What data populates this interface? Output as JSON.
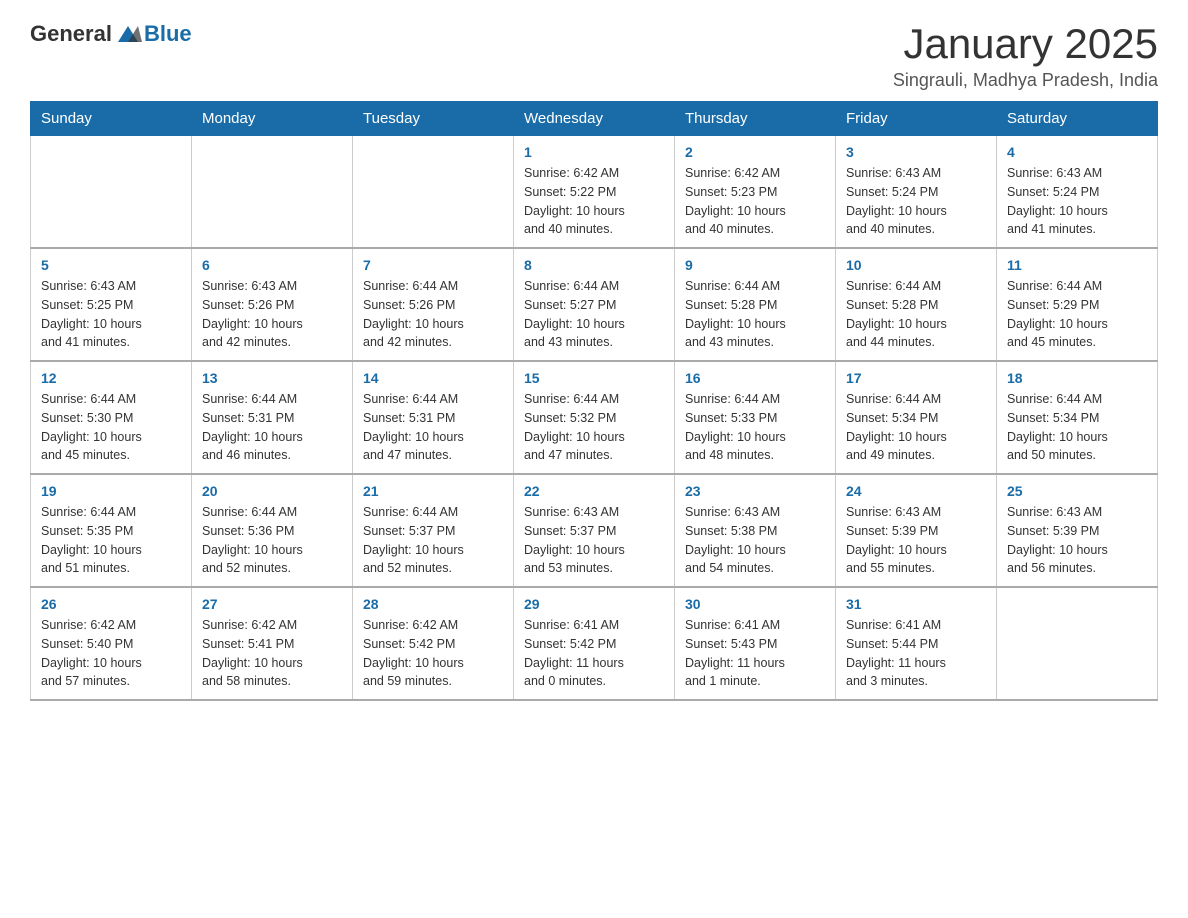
{
  "header": {
    "logo_general": "General",
    "logo_blue": "Blue",
    "title": "January 2025",
    "subtitle": "Singrauli, Madhya Pradesh, India"
  },
  "columns": [
    "Sunday",
    "Monday",
    "Tuesday",
    "Wednesday",
    "Thursday",
    "Friday",
    "Saturday"
  ],
  "weeks": [
    [
      {
        "day": "",
        "info": ""
      },
      {
        "day": "",
        "info": ""
      },
      {
        "day": "",
        "info": ""
      },
      {
        "day": "1",
        "info": "Sunrise: 6:42 AM\nSunset: 5:22 PM\nDaylight: 10 hours\nand 40 minutes."
      },
      {
        "day": "2",
        "info": "Sunrise: 6:42 AM\nSunset: 5:23 PM\nDaylight: 10 hours\nand 40 minutes."
      },
      {
        "day": "3",
        "info": "Sunrise: 6:43 AM\nSunset: 5:24 PM\nDaylight: 10 hours\nand 40 minutes."
      },
      {
        "day": "4",
        "info": "Sunrise: 6:43 AM\nSunset: 5:24 PM\nDaylight: 10 hours\nand 41 minutes."
      }
    ],
    [
      {
        "day": "5",
        "info": "Sunrise: 6:43 AM\nSunset: 5:25 PM\nDaylight: 10 hours\nand 41 minutes."
      },
      {
        "day": "6",
        "info": "Sunrise: 6:43 AM\nSunset: 5:26 PM\nDaylight: 10 hours\nand 42 minutes."
      },
      {
        "day": "7",
        "info": "Sunrise: 6:44 AM\nSunset: 5:26 PM\nDaylight: 10 hours\nand 42 minutes."
      },
      {
        "day": "8",
        "info": "Sunrise: 6:44 AM\nSunset: 5:27 PM\nDaylight: 10 hours\nand 43 minutes."
      },
      {
        "day": "9",
        "info": "Sunrise: 6:44 AM\nSunset: 5:28 PM\nDaylight: 10 hours\nand 43 minutes."
      },
      {
        "day": "10",
        "info": "Sunrise: 6:44 AM\nSunset: 5:28 PM\nDaylight: 10 hours\nand 44 minutes."
      },
      {
        "day": "11",
        "info": "Sunrise: 6:44 AM\nSunset: 5:29 PM\nDaylight: 10 hours\nand 45 minutes."
      }
    ],
    [
      {
        "day": "12",
        "info": "Sunrise: 6:44 AM\nSunset: 5:30 PM\nDaylight: 10 hours\nand 45 minutes."
      },
      {
        "day": "13",
        "info": "Sunrise: 6:44 AM\nSunset: 5:31 PM\nDaylight: 10 hours\nand 46 minutes."
      },
      {
        "day": "14",
        "info": "Sunrise: 6:44 AM\nSunset: 5:31 PM\nDaylight: 10 hours\nand 47 minutes."
      },
      {
        "day": "15",
        "info": "Sunrise: 6:44 AM\nSunset: 5:32 PM\nDaylight: 10 hours\nand 47 minutes."
      },
      {
        "day": "16",
        "info": "Sunrise: 6:44 AM\nSunset: 5:33 PM\nDaylight: 10 hours\nand 48 minutes."
      },
      {
        "day": "17",
        "info": "Sunrise: 6:44 AM\nSunset: 5:34 PM\nDaylight: 10 hours\nand 49 minutes."
      },
      {
        "day": "18",
        "info": "Sunrise: 6:44 AM\nSunset: 5:34 PM\nDaylight: 10 hours\nand 50 minutes."
      }
    ],
    [
      {
        "day": "19",
        "info": "Sunrise: 6:44 AM\nSunset: 5:35 PM\nDaylight: 10 hours\nand 51 minutes."
      },
      {
        "day": "20",
        "info": "Sunrise: 6:44 AM\nSunset: 5:36 PM\nDaylight: 10 hours\nand 52 minutes."
      },
      {
        "day": "21",
        "info": "Sunrise: 6:44 AM\nSunset: 5:37 PM\nDaylight: 10 hours\nand 52 minutes."
      },
      {
        "day": "22",
        "info": "Sunrise: 6:43 AM\nSunset: 5:37 PM\nDaylight: 10 hours\nand 53 minutes."
      },
      {
        "day": "23",
        "info": "Sunrise: 6:43 AM\nSunset: 5:38 PM\nDaylight: 10 hours\nand 54 minutes."
      },
      {
        "day": "24",
        "info": "Sunrise: 6:43 AM\nSunset: 5:39 PM\nDaylight: 10 hours\nand 55 minutes."
      },
      {
        "day": "25",
        "info": "Sunrise: 6:43 AM\nSunset: 5:39 PM\nDaylight: 10 hours\nand 56 minutes."
      }
    ],
    [
      {
        "day": "26",
        "info": "Sunrise: 6:42 AM\nSunset: 5:40 PM\nDaylight: 10 hours\nand 57 minutes."
      },
      {
        "day": "27",
        "info": "Sunrise: 6:42 AM\nSunset: 5:41 PM\nDaylight: 10 hours\nand 58 minutes."
      },
      {
        "day": "28",
        "info": "Sunrise: 6:42 AM\nSunset: 5:42 PM\nDaylight: 10 hours\nand 59 minutes."
      },
      {
        "day": "29",
        "info": "Sunrise: 6:41 AM\nSunset: 5:42 PM\nDaylight: 11 hours\nand 0 minutes."
      },
      {
        "day": "30",
        "info": "Sunrise: 6:41 AM\nSunset: 5:43 PM\nDaylight: 11 hours\nand 1 minute."
      },
      {
        "day": "31",
        "info": "Sunrise: 6:41 AM\nSunset: 5:44 PM\nDaylight: 11 hours\nand 3 minutes."
      },
      {
        "day": "",
        "info": ""
      }
    ]
  ]
}
